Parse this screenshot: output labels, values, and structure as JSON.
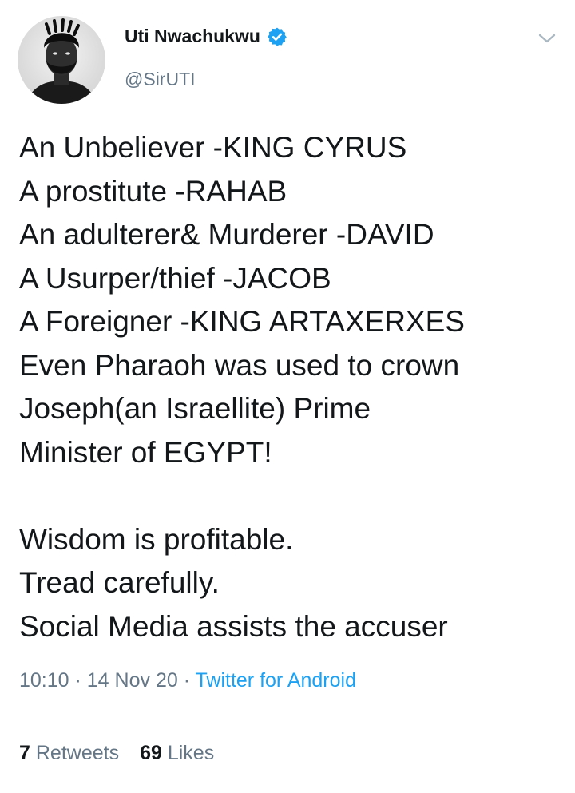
{
  "author": {
    "display_name": "Uti Nwachukwu",
    "handle": "@SirUTI",
    "verified": true,
    "verified_badge_color": "#1da1f2"
  },
  "tweet": {
    "lines": [
      "An Unbeliever -KING CYRUS",
      "A prostitute -RAHAB",
      "An adulterer& Murderer -DAVID",
      "A Usurper/thief -JACOB",
      "A Foreigner -KING ARTAXERXES",
      "Even Pharaoh was used to crown",
      "Joseph(an Israellite) Prime",
      "Minister of EGYPT!",
      "",
      "Wisdom is profitable.",
      "Tread carefully.",
      "Social Media assists the accuser"
    ]
  },
  "meta": {
    "time": "10:10",
    "separator": " · ",
    "date": "14 Nov 20",
    "source": "Twitter for Android"
  },
  "stats": {
    "retweets_count": "7",
    "retweets_label": "Retweets",
    "likes_count": "69",
    "likes_label": "Likes"
  },
  "icons": {
    "menu": "chevron-down-icon",
    "verified": "verified-badge-icon"
  },
  "colors": {
    "text": "#14171a",
    "secondary": "#657786",
    "link": "#1da1f2",
    "divider": "#dfe3e7"
  }
}
